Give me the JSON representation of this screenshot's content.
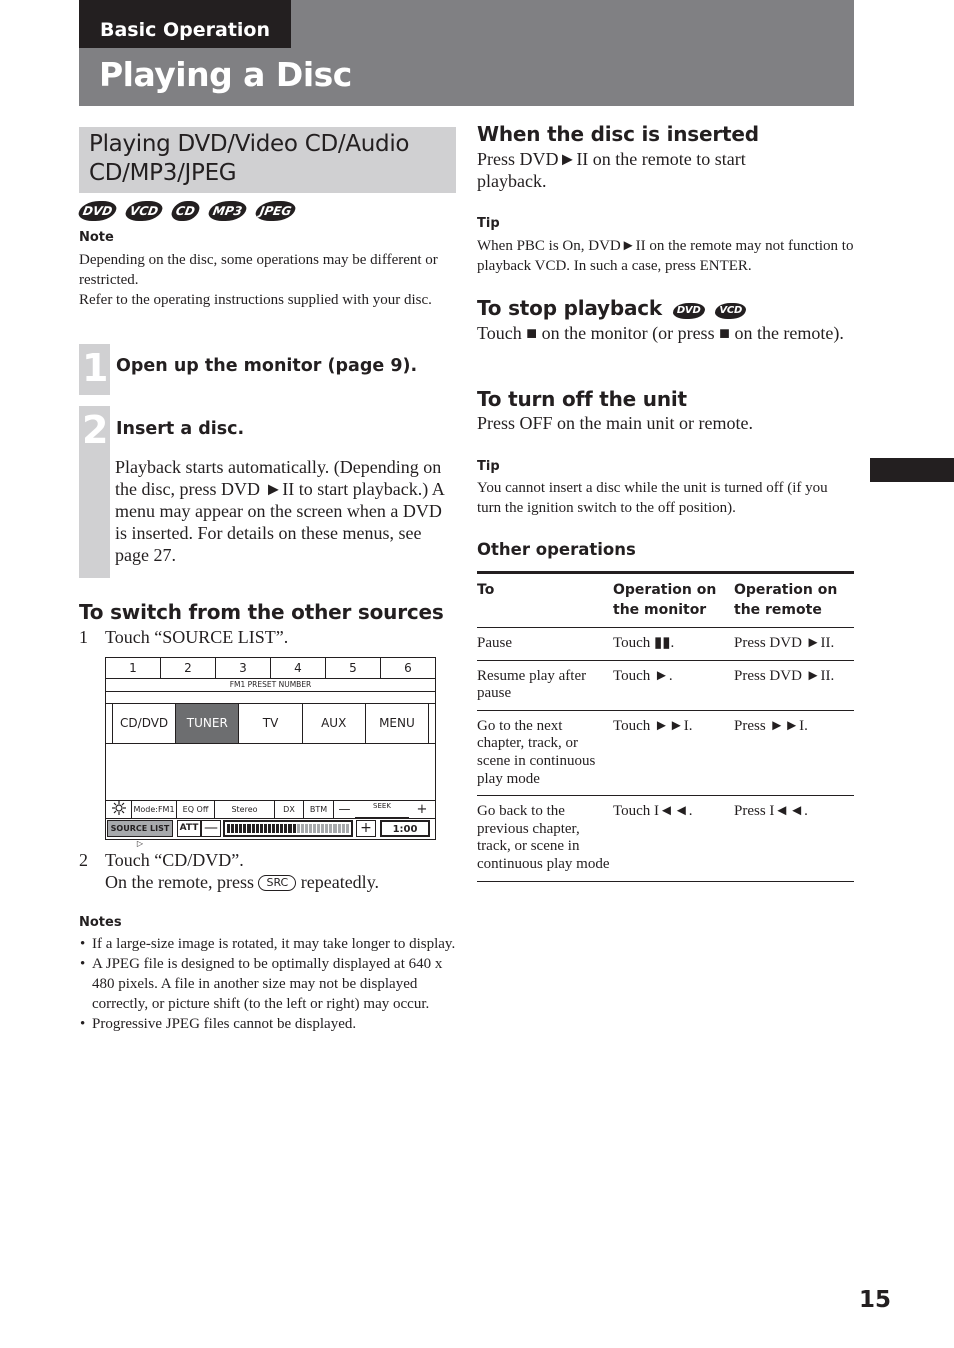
{
  "header": {
    "section": "Basic Operation",
    "title": "Playing a Disc"
  },
  "left": {
    "banner": "Playing DVD/Video CD/Audio CD/MP3/JPEG",
    "disc_icons": [
      "DVD",
      "VCD",
      "CD",
      "MP3",
      "JPEG"
    ],
    "note_label": "Note",
    "note_text_1": "Depending on the disc, some operations may be different or restricted.",
    "note_text_2": "Refer to the operating instructions supplied with your disc.",
    "step1": {
      "num": "1",
      "title": "Open up the monitor (page 9)."
    },
    "step2": {
      "num": "2",
      "title": "Insert a disc.",
      "body": "Playback starts automatically. (Depending on the disc, press DVD ►II to start playback.) A menu may appear on the screen when a DVD is inserted. For details on these menus, see page 27."
    },
    "switch_heading": "To switch from the other sources",
    "switch_step1_num": "1",
    "switch_step1": "Touch “SOURCE LIST”.",
    "switch_step2_num": "2",
    "switch_step2": "Touch “CD/DVD”.",
    "remote_prefix": "On the remote, press",
    "remote_key": "SRC",
    "remote_suffix": "repeatedly.",
    "notes_label": "Notes",
    "notes": [
      "If a large-size image is rotated, it may take longer to display.",
      "A JPEG file is designed to be optimally displayed at 640 x 480 pixels. A file in another size may not be displayed correctly, or picture shift (to the left or right) may occur.",
      "Progressive JPEG files cannot be displayed."
    ]
  },
  "device_screen": {
    "presets": [
      "1",
      "2",
      "3",
      "4",
      "5",
      "6"
    ],
    "preset_label": "FM1 PRESET NUMBER",
    "sources": [
      "CD/DVD",
      "TUNER",
      "TV",
      "AUX",
      "MENU"
    ],
    "active_source": "TUNER",
    "status": {
      "mode": "Mode:FM1",
      "eq": "EQ Off",
      "stereo": "Stereo",
      "dx": "DX",
      "btm": "BTM",
      "seek_minus": "—",
      "seek": "SEEK",
      "seek_plus": "+"
    },
    "source_list": "SOURCE LIST ▷",
    "att": "ATT",
    "vol_minus": "—",
    "vol_plus": "+",
    "volume_level": 0.55,
    "time": "1:00"
  },
  "right": {
    "inserted_heading": "When the disc is inserted",
    "inserted_text": "Press DVD►II on the remote to start playback.",
    "tip1_label": "Tip",
    "tip1_text": "When PBC is On, DVD►II on the remote may not function to playback VCD. In such a case, press ENTER.",
    "stop_heading": "To stop playback",
    "stop_icons": [
      "DVD",
      "VCD"
    ],
    "stop_text": "Touch ■ on the monitor (or press ■ on the remote).",
    "off_heading": "To turn off the unit",
    "off_text": "Press OFF on the main unit or remote.",
    "tip2_label": "Tip",
    "tip2_text": "You cannot insert a disc while the unit is turned off (if you turn the ignition switch to the off position).",
    "other_heading": "Other operations",
    "table": {
      "headers": [
        "To",
        "Operation on the monitor",
        "Operation on the remote"
      ],
      "rows": [
        [
          "Pause",
          "Touch ▮▮.",
          "Press DVD ►II."
        ],
        [
          "Resume play after pause",
          "Touch ►.",
          "Press DVD ►II."
        ],
        [
          "Go to the next chapter, track, or scene in continuous play mode",
          "Touch ►►I.",
          "Press ►►I."
        ],
        [
          "Go back to the previous chapter, track, or scene in continuous play mode",
          "Touch I◄◄.",
          "Press I◄◄."
        ]
      ]
    }
  },
  "page_number": "15"
}
